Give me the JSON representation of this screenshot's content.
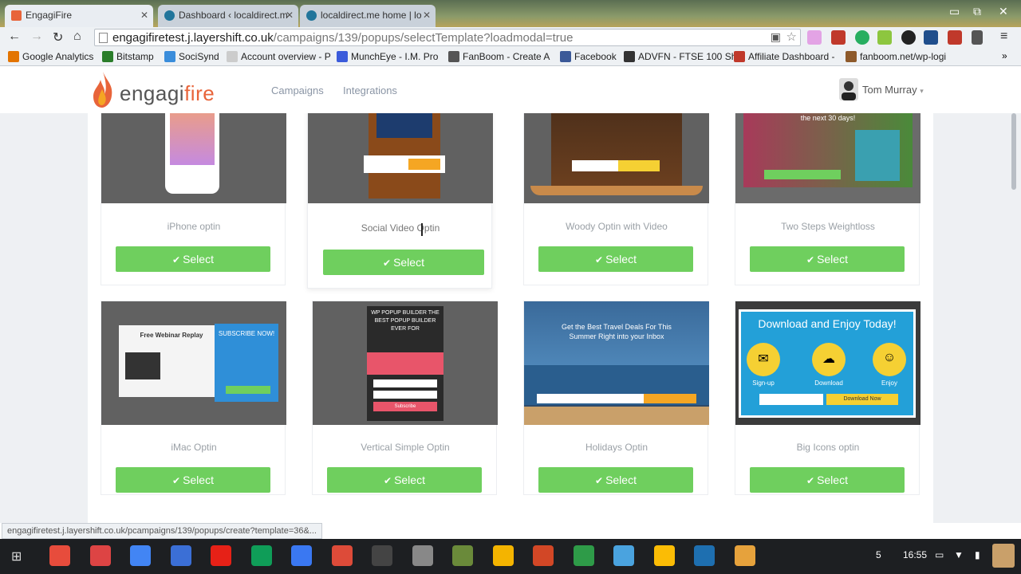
{
  "browser": {
    "tabs": [
      {
        "label": "EngagiFire"
      },
      {
        "label": "Dashboard ‹ localdirect.m"
      },
      {
        "label": "localdirect.me home | lo"
      }
    ],
    "url_host": "engagifiretest.j.layershift.co.uk",
    "url_path": "/campaigns/139/popups/selectTemplate?loadmodal=true",
    "bookmarks": [
      {
        "label": "Google Analytics",
        "color": "#e37400"
      },
      {
        "label": "Bitstamp",
        "color": "#2a7d2a"
      },
      {
        "label": "SociSynd",
        "color": "#3a8ddb"
      },
      {
        "label": "Account overview - P",
        "color": "#cccccc"
      },
      {
        "label": "MunchEye - I.M. Pro",
        "color": "#3b5bdb"
      },
      {
        "label": "FanBoom - Create A",
        "color": "#555555"
      },
      {
        "label": "Facebook",
        "color": "#3b5998"
      },
      {
        "label": "ADVFN - FTSE 100 Sh",
        "color": "#333333"
      },
      {
        "label": "Affiliate Dashboard -",
        "color": "#c0392b"
      },
      {
        "label": "fanboom.net/wp-logi",
        "color": "#8e5a2b"
      }
    ]
  },
  "app": {
    "logo_prefix": "engagi",
    "logo_suffix": "fire",
    "nav": [
      "Campaigns",
      "Integrations"
    ],
    "user": "Tom Murray"
  },
  "templates": {
    "select_label": "Select",
    "row1": [
      {
        "title": "iPhone optin"
      },
      {
        "title": "Social Video Optin"
      },
      {
        "title": "Woody Optin with Video"
      },
      {
        "title": "Two Steps Weightloss"
      }
    ],
    "row2": [
      {
        "title": "iMac Optin"
      },
      {
        "title": "Vertical Simple Optin"
      },
      {
        "title": "Holidays Optin"
      },
      {
        "title": "Big Icons optin"
      }
    ]
  },
  "thumb_text": {
    "imac_heading": "Free Webinar Replay",
    "imac_subscribe": "SUBSCRIBE NOW!",
    "vertical_heading": "WP POPUP BUILDER THE BEST POPUP BUILDER EVER FOR",
    "vertical_button": "Subscribe",
    "holidays_heading": "Get the Best Travel Deals For This Summer Right into your Inbox",
    "bigicons_heading": "Download and Enjoy Today!",
    "bigicons_steps": [
      "Sign-up",
      "Download",
      "Enjoy"
    ],
    "bigicons_button": "Download Now",
    "weightloss_heading": "the next 30 days!"
  },
  "status_url": "engagifiretest.j.layershift.co.uk/pcampaigns/139/popups/create?template=36&...",
  "shelf": {
    "badge": "5",
    "time": "16:55"
  }
}
